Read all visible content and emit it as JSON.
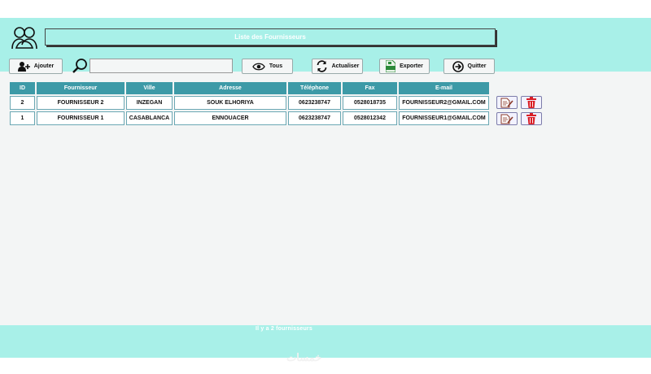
{
  "header": {
    "title": "Liste des Fournisseurs"
  },
  "toolbar": {
    "add_label": "Ajouter",
    "search_value": "",
    "all_label": "Tous",
    "refresh_label": "Actualiser",
    "export_label": "Exporter",
    "quit_label": "Quitter"
  },
  "table": {
    "columns": [
      "ID",
      "Fournisseur",
      "Ville",
      "Adresse",
      "Téléphone",
      "Fax",
      "E-mail"
    ],
    "rows": [
      {
        "id": "2",
        "name": "FOURNISSEUR 2",
        "city": "INZEGAN",
        "address": "SOUK ELHORIYA",
        "phone": "0623238747",
        "fax": "0528018735",
        "email": "FOURNISSEUR2@GMAIL.COM"
      },
      {
        "id": "1",
        "name": "FOURNISSEUR 1",
        "city": "CASABLANCA",
        "address": "ENNOUACER",
        "phone": "0623238747",
        "fax": "0528012342",
        "email": "FOURNISSEUR1@GMAIL.COM"
      }
    ]
  },
  "footer": {
    "status": "Il y    a   2 fournisseurs"
  },
  "watermark": "خمسات",
  "colors": {
    "background": "#a8f0e8",
    "header_cell": "#3d9aa7",
    "delete": "#d91e26",
    "edit": "#8b3a2a"
  },
  "icons": [
    "users-icon",
    "add-user-icon",
    "search-icon",
    "eye-icon",
    "refresh-icon",
    "excel-icon",
    "exit-icon",
    "edit-icon",
    "trash-icon"
  ]
}
